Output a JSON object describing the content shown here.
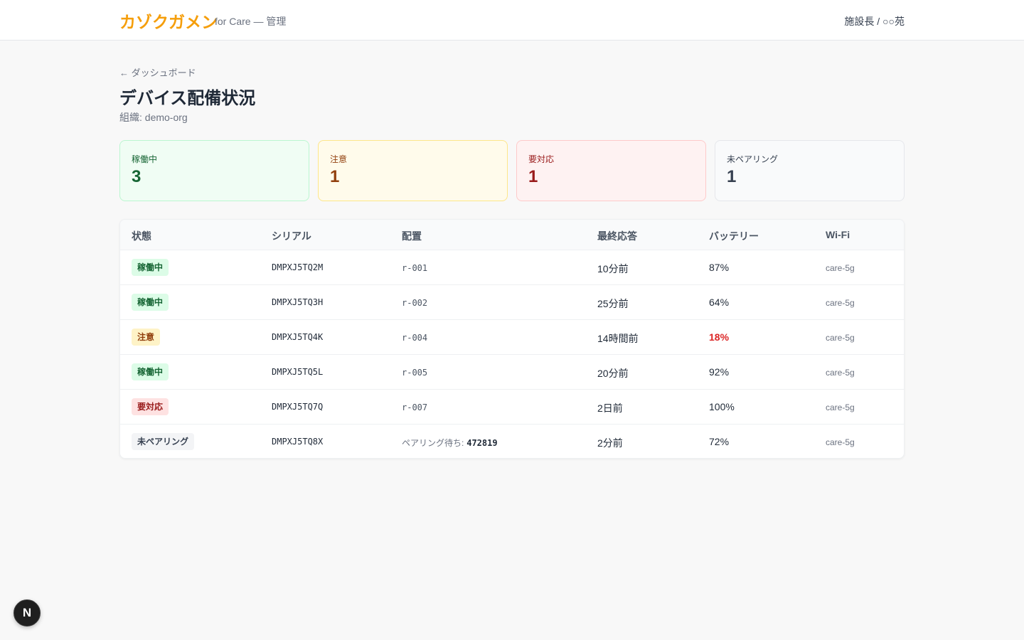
{
  "header": {
    "brand": "カゾクガメン",
    "brand_sub": "for Care — 管理",
    "user": "施設長 / ○○苑"
  },
  "page": {
    "back_link": "← ダッシュボード",
    "title": "デバイス配備状況",
    "org": "組織: demo-org"
  },
  "stats": [
    {
      "label": "稼働中",
      "value": "3",
      "status": "active"
    },
    {
      "label": "注意",
      "value": "1",
      "status": "warn"
    },
    {
      "label": "要対応",
      "value": "1",
      "status": "alert"
    },
    {
      "label": "未ペアリング",
      "value": "1",
      "status": "unpaired"
    }
  ],
  "table": {
    "columns": [
      "状態",
      "シリアル",
      "配置",
      "最終応答",
      "バッテリー",
      "Wi-Fi"
    ],
    "rows": [
      {
        "status": "稼働中",
        "status_kind": "active",
        "serial": "DMPXJ5TQ2M",
        "placement": "r-001",
        "last_response": "10分前",
        "battery": "87%",
        "wifi": "care-5g"
      },
      {
        "status": "稼働中",
        "status_kind": "active",
        "serial": "DMPXJ5TQ3H",
        "placement": "r-002",
        "last_response": "25分前",
        "battery": "64%",
        "wifi": "care-5g"
      },
      {
        "status": "注意",
        "status_kind": "warn",
        "serial": "DMPXJ5TQ4K",
        "placement": "r-004",
        "last_response": "14時間前",
        "battery": "18%",
        "battery_low": true,
        "wifi": "care-5g"
      },
      {
        "status": "稼働中",
        "status_kind": "active",
        "serial": "DMPXJ5TQ5L",
        "placement": "r-005",
        "last_response": "20分前",
        "battery": "92%",
        "wifi": "care-5g"
      },
      {
        "status": "要対応",
        "status_kind": "alert",
        "serial": "DMPXJ5TQ7Q",
        "placement": "r-007",
        "last_response": "2日前",
        "battery": "100%",
        "wifi": "care-5g"
      },
      {
        "status": "未ペアリング",
        "status_kind": "unpaired",
        "serial": "DMPXJ5TQ8X",
        "placement_label": "ペアリング待ち:",
        "pairing_code": "472819",
        "last_response": "2分前",
        "battery": "72%",
        "wifi": "care-5g"
      }
    ]
  },
  "fab": {
    "label": "N"
  },
  "colors": {
    "brand": "#f59e0b",
    "active": "#166534",
    "warn": "#92400e",
    "alert": "#991b1b",
    "low_battery": "#dc2626"
  }
}
